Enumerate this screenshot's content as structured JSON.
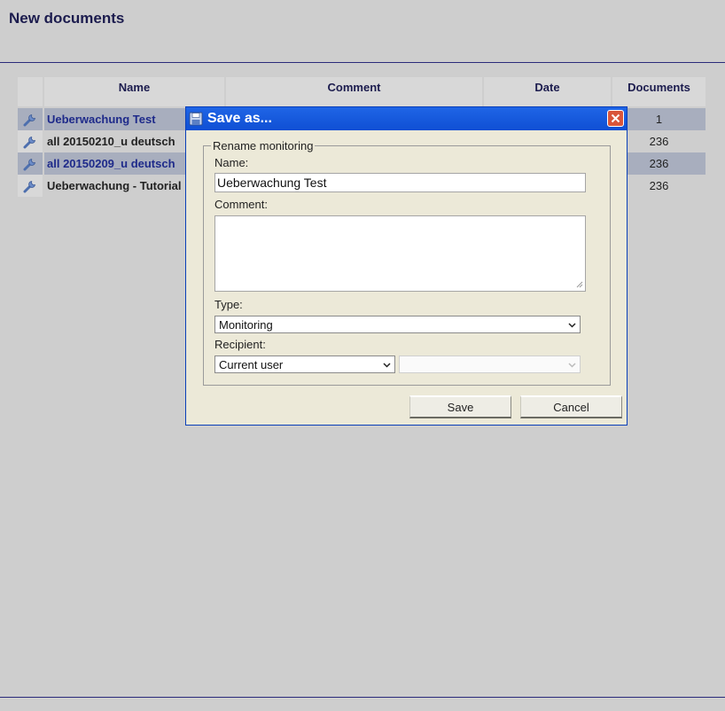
{
  "page": {
    "title": "New documents"
  },
  "table": {
    "headers": {
      "name": "Name",
      "comment": "Comment",
      "date": "Date",
      "documents": "Documents"
    },
    "rows": [
      {
        "name": "Ueberwachung Test",
        "documents": "1",
        "selected": true
      },
      {
        "name": "all 20150210_u deutsch",
        "documents": "236",
        "selected": false
      },
      {
        "name": "all 20150209_u deutsch",
        "documents": "236",
        "selected": true
      },
      {
        "name": "Ueberwachung - Tutorial",
        "documents": "236",
        "selected": false
      }
    ]
  },
  "dialog": {
    "title": "Save as...",
    "group_label": "Rename monitoring",
    "name_label": "Name:",
    "name_value": "Ueberwachung Test",
    "comment_label": "Comment:",
    "comment_value": "",
    "type_label": "Type:",
    "type_value": "Monitoring",
    "recipient_label": "Recipient:",
    "recipient_value": "Current user",
    "recipient_secondary_value": "",
    "save_label": "Save",
    "cancel_label": "Cancel"
  },
  "colors": {
    "titlebar": "#1f65e6",
    "selected_row": "#a8aebe",
    "heading": "#1c1c4e"
  }
}
